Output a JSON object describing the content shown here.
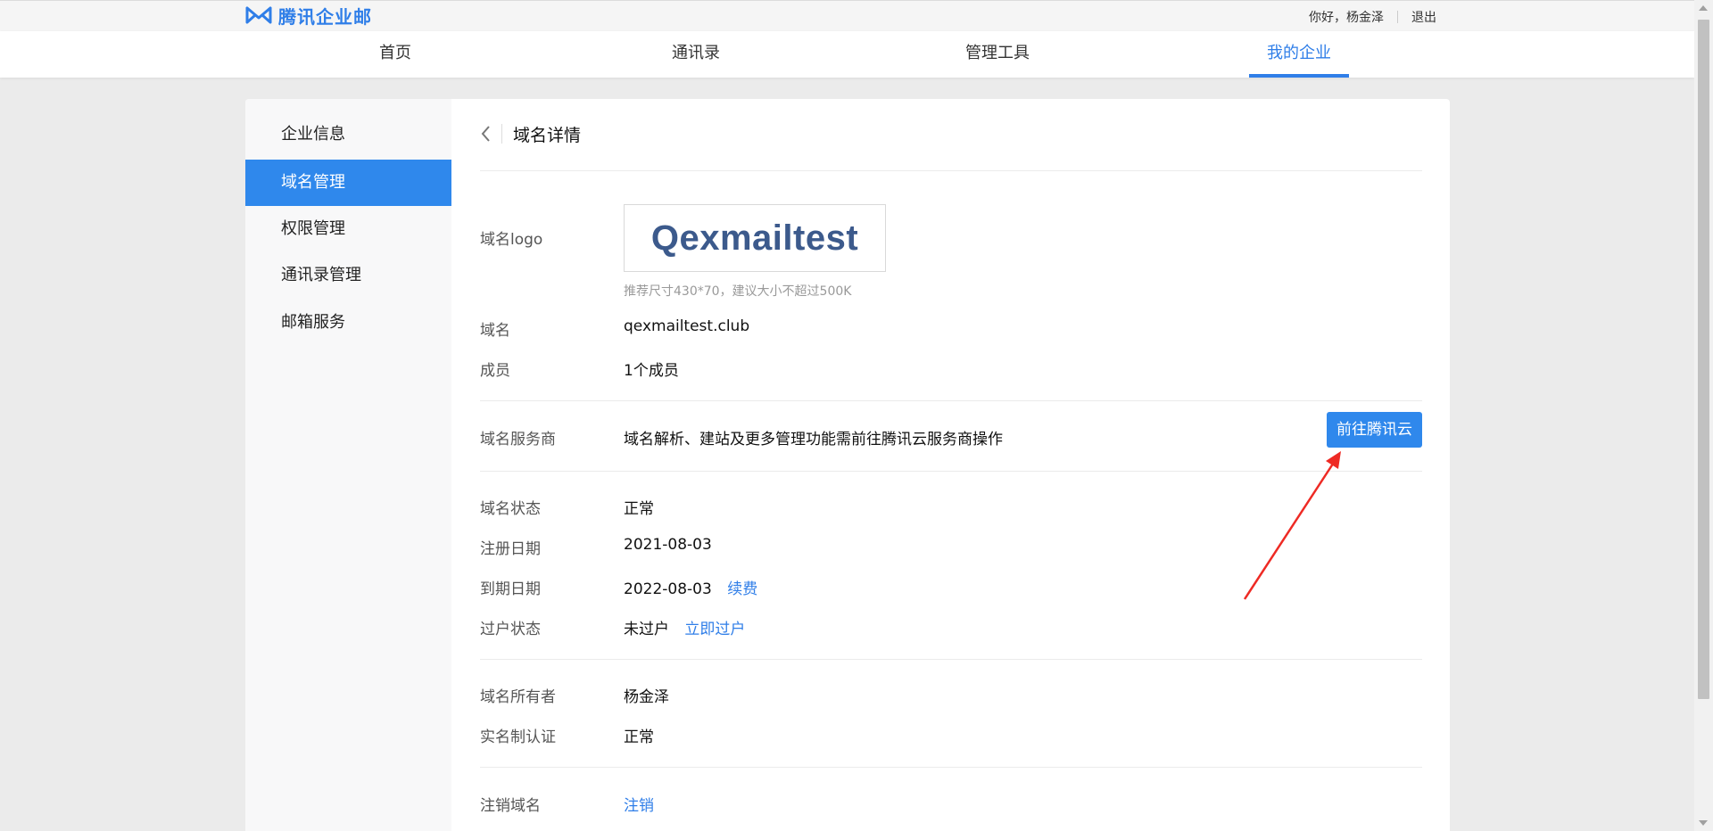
{
  "header": {
    "brand": "腾讯企业邮",
    "greeting": "你好，杨金泽",
    "logout": "退出"
  },
  "nav": {
    "items": [
      {
        "label": "首页",
        "active": false
      },
      {
        "label": "通讯录",
        "active": false
      },
      {
        "label": "管理工具",
        "active": false
      },
      {
        "label": "我的企业",
        "active": true
      }
    ]
  },
  "sidebar": {
    "items": [
      {
        "label": "企业信息",
        "active": false
      },
      {
        "label": "域名管理",
        "active": true
      },
      {
        "label": "权限管理",
        "active": false
      },
      {
        "label": "通讯录管理",
        "active": false
      },
      {
        "label": "邮箱服务",
        "active": false
      }
    ]
  },
  "detail": {
    "title": "域名详情",
    "logo_label": "域名logo",
    "logo_text": "Qexmailtest",
    "logo_hint": "推荐尺寸430*70，建议大小不超过500K",
    "domain_label": "域名",
    "domain_value": "qexmailtest.club",
    "members_label": "成员",
    "members_value": "1个成员",
    "provider_label": "域名服务商",
    "provider_value": "域名解析、建站及更多管理功能需前往腾讯云服务商操作",
    "provider_button": "前往腾讯云",
    "status_label": "域名状态",
    "status_value": "正常",
    "reg_label": "注册日期",
    "reg_value": "2021-08-03",
    "expire_label": "到期日期",
    "expire_value": "2022-08-03",
    "renew_link": "续费",
    "transfer_label": "过户状态",
    "transfer_value": "未过户",
    "transfer_link": "立即过户",
    "owner_label": "域名所有者",
    "owner_value": "杨金泽",
    "realname_label": "实名制认证",
    "realname_value": "正常",
    "cancel_label": "注销域名",
    "cancel_link": "注销"
  },
  "colors": {
    "accent": "#2f7ee8",
    "annotation_arrow": "#ee2a24"
  },
  "icons": {
    "logo": "tencent-exmail-logo-icon",
    "back": "chevron-left-icon"
  }
}
